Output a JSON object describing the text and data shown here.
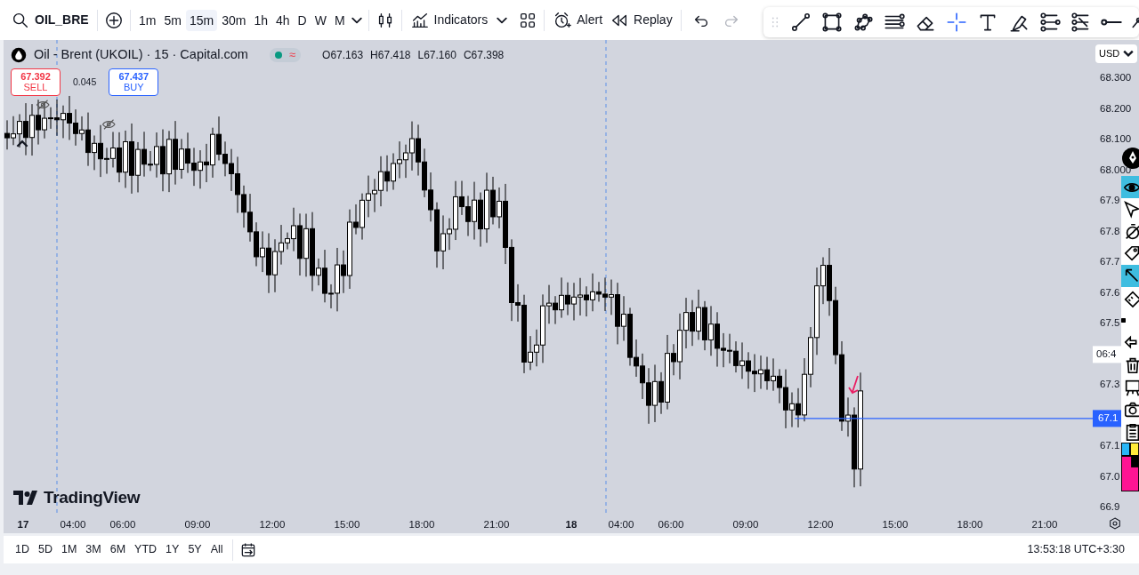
{
  "toolbar": {
    "symbol": "OIL_BRE",
    "intervals": [
      {
        "label": "1m",
        "selected": false
      },
      {
        "label": "5m",
        "selected": false
      },
      {
        "label": "15m",
        "selected": true
      },
      {
        "label": "30m",
        "selected": false
      },
      {
        "label": "1h",
        "selected": false
      },
      {
        "label": "4h",
        "selected": false
      },
      {
        "label": "D",
        "selected": false
      },
      {
        "label": "W",
        "selected": false
      },
      {
        "label": "M",
        "selected": false
      }
    ],
    "buttons": [
      {
        "kind": "indicators",
        "label": "Indicators"
      },
      {
        "kind": "alert",
        "label": "Alert"
      },
      {
        "kind": "replay",
        "label": "Replay"
      }
    ],
    "undo": {
      "disabled": false
    },
    "redo": {
      "disabled": true
    }
  },
  "drawing_tools": [
    {
      "kind": "line",
      "selected": false
    },
    {
      "kind": "rect",
      "selected": false
    },
    {
      "kind": "nodes",
      "selected": false
    },
    {
      "kind": "fib",
      "selected": false
    },
    {
      "kind": "eraser",
      "selected": false
    },
    {
      "kind": "crosshair",
      "selected": true
    },
    {
      "kind": "text",
      "selected": false
    },
    {
      "kind": "highlighter",
      "selected": false
    },
    {
      "kind": "levels",
      "selected": false
    },
    {
      "kind": "levels2",
      "selected": false
    },
    {
      "kind": "hline",
      "selected": false
    },
    {
      "kind": "path",
      "selected": false
    }
  ],
  "legend": {
    "title": "Oil - Brent (UKOIL) · 15 · Capital.com",
    "status_symbol": "≈",
    "ohlc": [
      {
        "label": "O",
        "value": "67.163"
      },
      {
        "label": "H",
        "value": "67.418"
      },
      {
        "label": "L",
        "value": "67.160"
      },
      {
        "label": "C",
        "value": "67.398"
      }
    ]
  },
  "trade": {
    "sell": {
      "price": "67.392",
      "label": "SELL"
    },
    "spread": "0.045",
    "buy": {
      "price": "67.437",
      "label": "BUY"
    }
  },
  "watermark": "TradingView",
  "price_axis": {
    "currency": "USD",
    "labels": [
      "68.300",
      "68.200",
      "68.100",
      "68.000",
      "67.9",
      "67.8",
      "67.7",
      "67.6",
      "67.5",
      "67.3",
      "67.1",
      "67.0",
      "66.9"
    ],
    "last_price": "67.1",
    "countdown": "06:4"
  },
  "time_axis": [
    {
      "kind": "day",
      "label": "17"
    },
    {
      "kind": "time",
      "label": "04:00"
    },
    {
      "kind": "time",
      "label": "06:00"
    },
    {
      "kind": "time",
      "label": "09:00"
    },
    {
      "kind": "time",
      "label": "12:00"
    },
    {
      "kind": "time",
      "label": "15:00"
    },
    {
      "kind": "time",
      "label": "18:00"
    },
    {
      "kind": "time",
      "label": "21:00"
    },
    {
      "kind": "day",
      "label": "18"
    },
    {
      "kind": "time",
      "label": "04:00"
    },
    {
      "kind": "time",
      "label": "06:00"
    },
    {
      "kind": "time",
      "label": "09:00"
    },
    {
      "kind": "time",
      "label": "12:00"
    },
    {
      "kind": "time",
      "label": "15:00"
    },
    {
      "kind": "time",
      "label": "18:00"
    },
    {
      "kind": "time",
      "label": "21:00"
    }
  ],
  "side_tools": [
    {
      "kind": "eye",
      "selected": true
    },
    {
      "kind": "cursor",
      "selected": false
    },
    {
      "kind": "timer",
      "selected": false
    },
    {
      "kind": "tag",
      "selected": false
    },
    {
      "kind": "arrow",
      "selected": true
    },
    {
      "kind": "ruler",
      "selected": false
    },
    {
      "kind": "dot",
      "selected": false
    },
    {
      "kind": "back",
      "selected": false
    },
    {
      "kind": "trash",
      "selected": false
    },
    {
      "kind": "easel",
      "selected": false
    },
    {
      "kind": "camera",
      "selected": false
    },
    {
      "kind": "clipboard",
      "selected": false
    }
  ],
  "ranges": [
    "1D",
    "5D",
    "1M",
    "3M",
    "6M",
    "YTD",
    "1Y",
    "5Y",
    "All"
  ],
  "clock": "13:53:18 UTC+3:30"
}
